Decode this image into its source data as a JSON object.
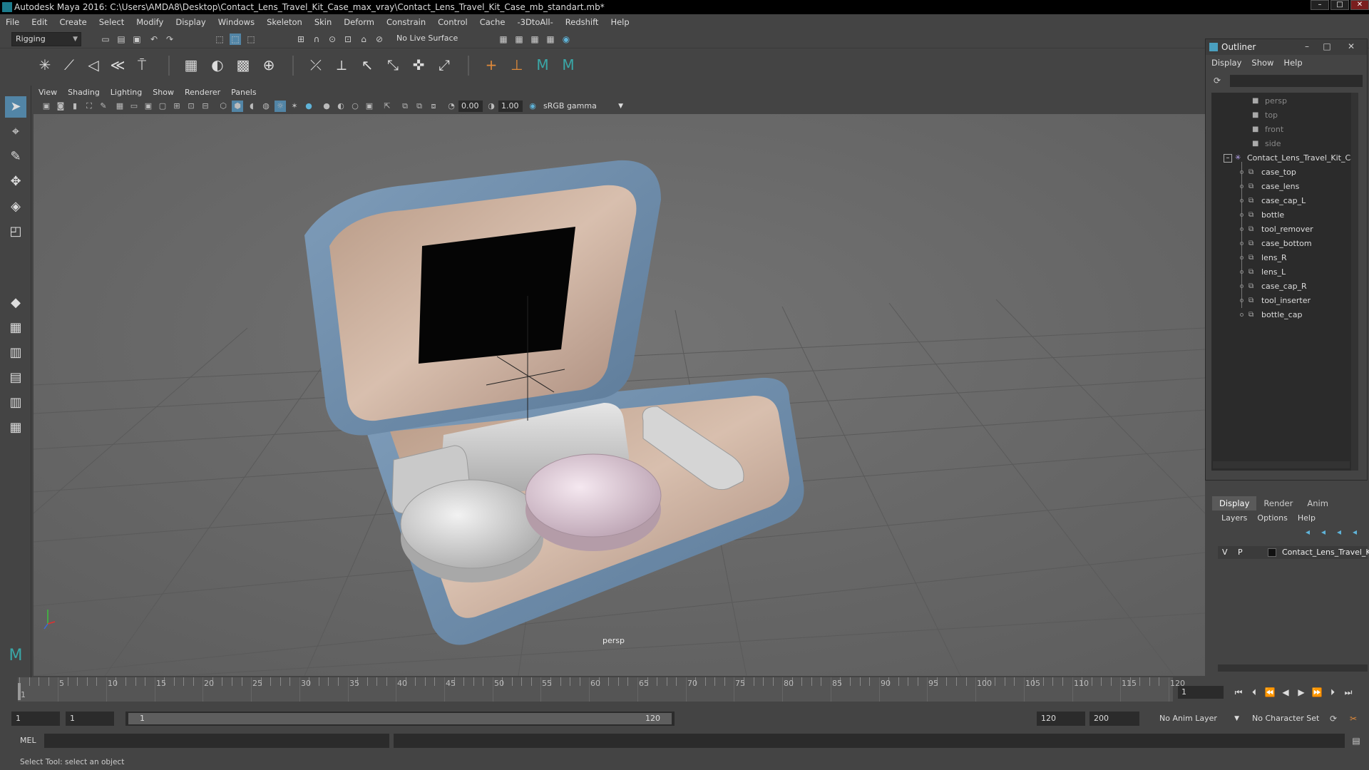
{
  "window": {
    "title": "Autodesk Maya 2016: C:\\Users\\AMDA8\\Desktop\\Contact_Lens_Travel_Kit_Case_max_vray\\Contact_Lens_Travel_Kit_Case_mb_standart.mb*",
    "minimize": "–",
    "maximize": "□",
    "close": "✕"
  },
  "menubar": [
    "File",
    "Edit",
    "Create",
    "Select",
    "Modify",
    "Display",
    "Windows",
    "Skeleton",
    "Skin",
    "Deform",
    "Constrain",
    "Control",
    "Cache",
    "-3DtoAll-",
    "Redshift",
    "Help"
  ],
  "statusline": {
    "menuset": "Rigging",
    "live_surface": "No Live Surface"
  },
  "viewport": {
    "menu": [
      "View",
      "Shading",
      "Lighting",
      "Show",
      "Renderer",
      "Panels"
    ],
    "exposure": "0.00",
    "gamma": "1.00",
    "colorspace": "sRGB gamma",
    "camera": "persp"
  },
  "outliner": {
    "title": "Outliner",
    "menu": [
      "Display",
      "Show",
      "Help"
    ],
    "cameras": [
      "persp",
      "top",
      "front",
      "side"
    ],
    "root": "Contact_Lens_Travel_Kit_Ca",
    "children": [
      "case_top",
      "case_lens",
      "case_cap_L",
      "bottle",
      "tool_remover",
      "case_bottom",
      "lens_R",
      "lens_L",
      "case_cap_R",
      "tool_inserter",
      "bottle_cap"
    ]
  },
  "layers": {
    "tabs": [
      "Display",
      "Render",
      "Anim"
    ],
    "active_tab": "Display",
    "menu": [
      "Layers",
      "Options",
      "Help"
    ],
    "row": {
      "v": "V",
      "p": "P",
      "name": "Contact_Lens_Travel_Ki"
    }
  },
  "timeline": {
    "ticks": [
      "1",
      "5",
      "10",
      "15",
      "20",
      "25",
      "30",
      "35",
      "40",
      "45",
      "50",
      "55",
      "60",
      "65",
      "70",
      "75",
      "80",
      "85",
      "90",
      "95",
      "100",
      "105",
      "110",
      "115",
      "120"
    ],
    "current_frame": "1"
  },
  "range": {
    "start": "1",
    "playback_start": "1",
    "slider_start": "1",
    "slider_end": "120",
    "playback_end": "120",
    "end": "200",
    "anim_layer": "No Anim Layer",
    "character_set": "No Character Set"
  },
  "command_line": {
    "label": "MEL"
  },
  "help_line": "Select Tool: select an object",
  "colors": {
    "selected_tool": "#5285a6",
    "grid": "#5d5d5d",
    "case_fabric": "#6f8fae",
    "case_lining": "#c9ad98"
  }
}
